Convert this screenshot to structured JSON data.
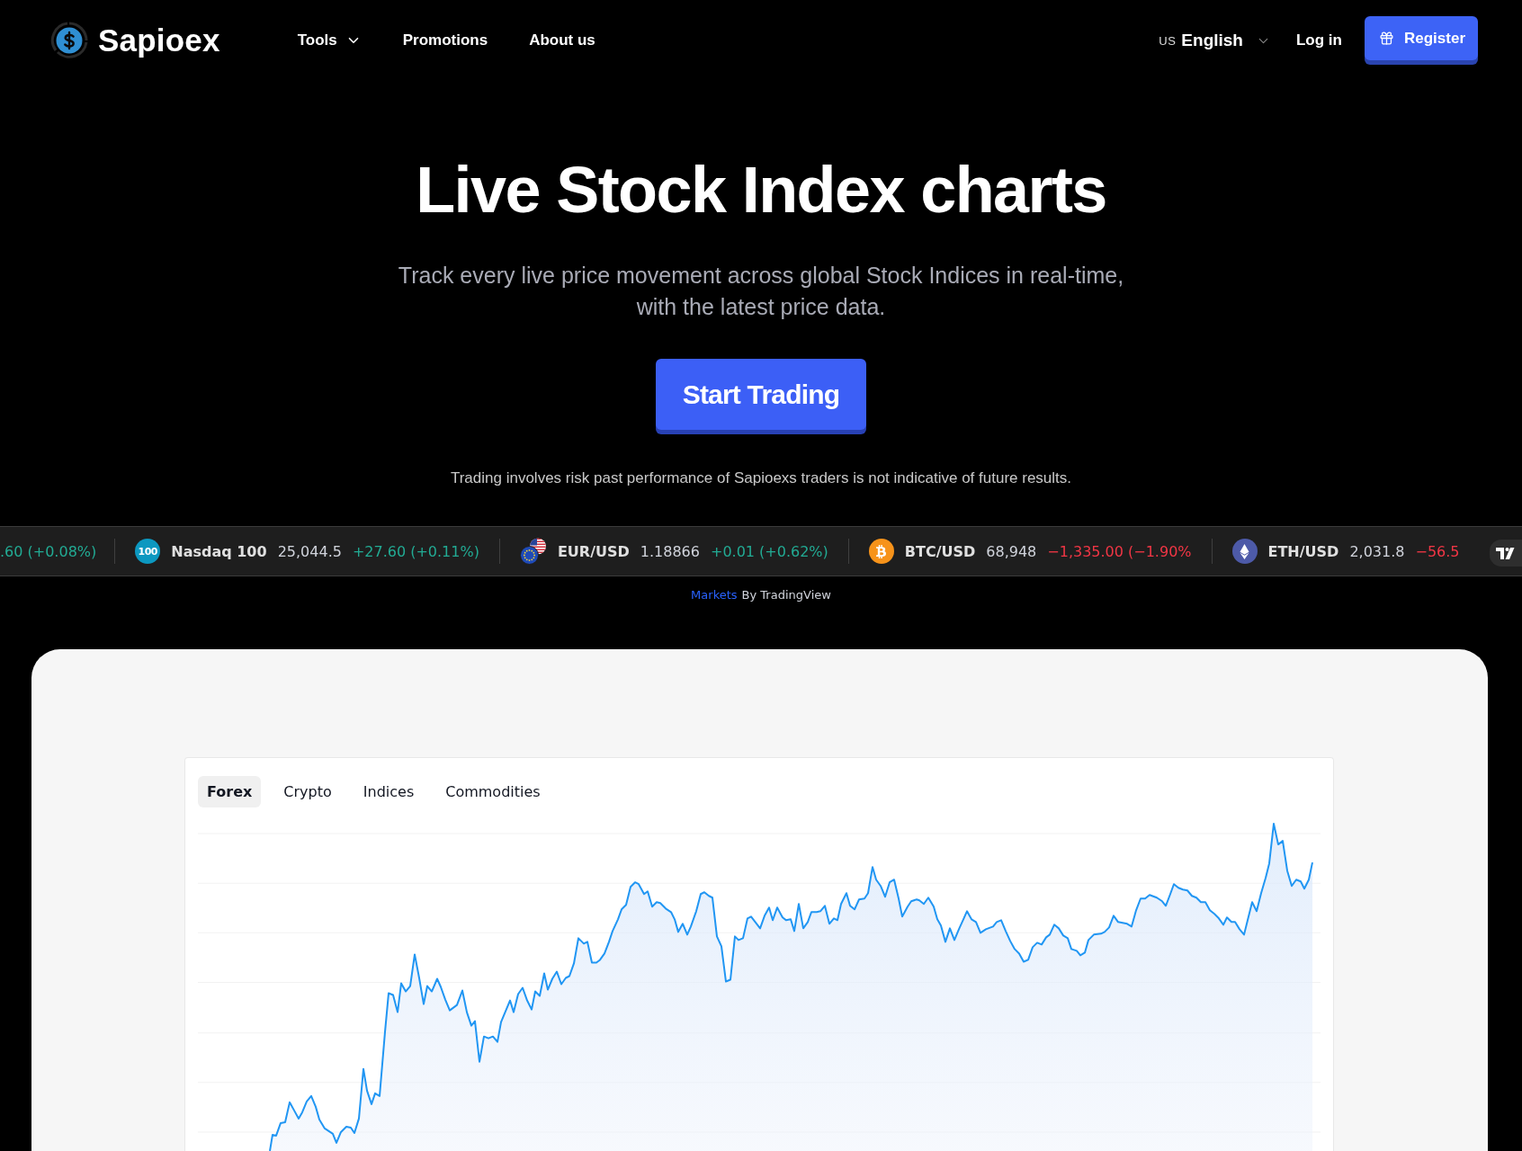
{
  "header": {
    "logo": "Sapioex",
    "nav": [
      {
        "label": "Tools",
        "dropdown": true
      },
      {
        "label": "Promotions",
        "dropdown": false
      },
      {
        "label": "About us",
        "dropdown": false
      }
    ],
    "language": {
      "flag": "US",
      "label": "English"
    },
    "login": "Log in",
    "register": "Register"
  },
  "hero": {
    "title": "Live Stock Index charts",
    "subtitle": "Track every live price movement across global Stock Indices in real-time, with the latest price data.",
    "cta": "Start Trading",
    "disclaimer": "Trading involves risk past performance of Sapioexs traders is not indicative of future results."
  },
  "ticker": {
    "items": [
      {
        "kind": "partial",
        "change": ".60 (+0.08%)",
        "color": "#22ab94"
      },
      {
        "kind": "index",
        "logo": "100",
        "name": "Nasdaq 100",
        "price": "25,044.5",
        "change": "+27.60 (+0.11%)",
        "color": "#22ab94"
      },
      {
        "kind": "forex",
        "name": "EUR/USD",
        "price": "1.18866",
        "change": "+0.01 (+0.62%)",
        "color": "#22ab94"
      },
      {
        "kind": "bitcoin",
        "name": "BTC/USD",
        "price": "68,948",
        "change": "−1,335.00 (−1.90%",
        "color": "#f23645"
      },
      {
        "kind": "ethereum",
        "name": "ETH/USD",
        "price": "2,031.8",
        "change": "−56.5",
        "color": "#f23645"
      }
    ]
  },
  "attribution": {
    "link": "Markets",
    "text": "By TradingView"
  },
  "widget": {
    "tabs": [
      {
        "label": "Forex",
        "selected": true
      },
      {
        "label": "Crypto",
        "selected": false
      },
      {
        "label": "Indices",
        "selected": false
      },
      {
        "label": "Commodities",
        "selected": false
      }
    ]
  }
}
